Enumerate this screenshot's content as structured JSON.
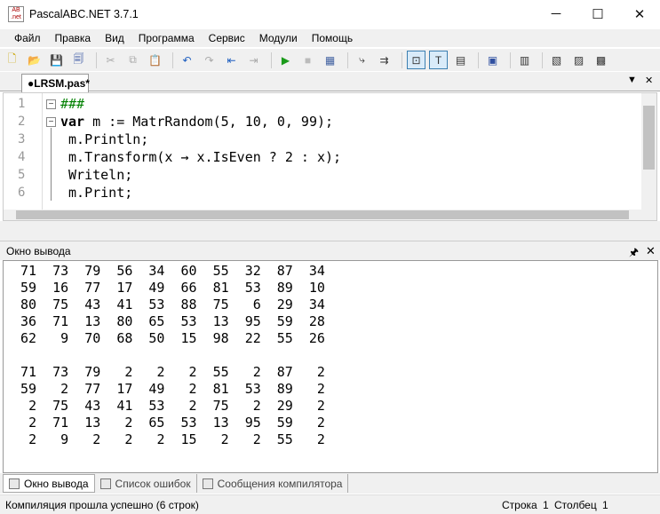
{
  "window": {
    "title": "PascalABC.NET 3.7.1",
    "icon_text": "AB .net",
    "minimize": "─",
    "maximize": "☐",
    "close": "✕"
  },
  "menu": [
    "Файл",
    "Правка",
    "Вид",
    "Программа",
    "Сервис",
    "Модули",
    "Помощь"
  ],
  "toolbar": [
    {
      "name": "new-file-icon",
      "glyph": "🗋",
      "color": "#c9a400"
    },
    {
      "name": "open-icon",
      "glyph": "📂",
      "color": "#d89a20"
    },
    {
      "name": "save-icon",
      "glyph": "💾",
      "color": "#3050a0"
    },
    {
      "name": "save-all-icon",
      "glyph": "🗐",
      "color": "#3050a0"
    },
    {
      "sep": true
    },
    {
      "name": "cut-icon",
      "glyph": "✂",
      "color": "#aaa"
    },
    {
      "name": "copy-icon",
      "glyph": "⧉",
      "color": "#aaa"
    },
    {
      "name": "paste-icon",
      "glyph": "📋",
      "color": "#a07020"
    },
    {
      "sep": true
    },
    {
      "name": "undo-icon",
      "glyph": "↶",
      "color": "#2060c0"
    },
    {
      "name": "redo-icon",
      "glyph": "↷",
      "color": "#aaa"
    },
    {
      "name": "indent-left-icon",
      "glyph": "⇤",
      "color": "#2060c0"
    },
    {
      "name": "indent-right-icon",
      "glyph": "⇥",
      "color": "#aaa"
    },
    {
      "sep": true
    },
    {
      "name": "run-icon",
      "glyph": "▶",
      "color": "#1a9a1a"
    },
    {
      "name": "stop-icon",
      "glyph": "■",
      "color": "#bbb"
    },
    {
      "name": "compile-icon",
      "glyph": "▦",
      "color": "#4060a0"
    },
    {
      "sep": true
    },
    {
      "name": "step-into-icon",
      "glyph": "⤷",
      "color": "#333"
    },
    {
      "name": "step-over-icon",
      "glyph": "⇉",
      "color": "#333"
    },
    {
      "sep": true
    },
    {
      "name": "output-window-icon",
      "glyph": "⊡",
      "color": "#333",
      "active": true
    },
    {
      "name": "text-window-icon",
      "glyph": "T",
      "color": "#333",
      "active": true
    },
    {
      "name": "format-icon",
      "glyph": "▤",
      "color": "#333"
    },
    {
      "sep": true
    },
    {
      "name": "debug-icon",
      "glyph": "▣",
      "color": "#3050a0"
    },
    {
      "sep": true
    },
    {
      "name": "code-icon",
      "glyph": "▥",
      "color": "#333"
    },
    {
      "sep": true
    },
    {
      "name": "form-icon",
      "glyph": "▧",
      "color": "#333"
    },
    {
      "name": "form-design-icon",
      "glyph": "▨",
      "color": "#333"
    },
    {
      "name": "form-run-icon",
      "glyph": "▩",
      "color": "#333"
    }
  ],
  "document_tab": {
    "label": "●LRSM.pas*",
    "menu": "▼",
    "close": "✕"
  },
  "editor": {
    "line_numbers": [
      "1",
      "2",
      "3",
      "4",
      "5",
      "6"
    ],
    "lines": [
      [
        {
          "t": "###",
          "c": "#008000"
        }
      ],
      [
        {
          "t": "var",
          "b": true
        },
        {
          "t": " m := MatrRandom(5, 10, 0, 99);"
        }
      ],
      [
        {
          "t": " m.Println;"
        }
      ],
      [
        {
          "t": " m.Transform(x → x.IsEven ? 2 : x);"
        }
      ],
      [
        {
          "t": " Writeln;"
        }
      ],
      [
        {
          "t": " m.Print;"
        }
      ]
    ]
  },
  "output_panel": {
    "title": "Окно вывода",
    "pin": "🖈",
    "close": "✕",
    "matrix_before": [
      [
        71,
        73,
        79,
        56,
        34,
        60,
        55,
        32,
        87,
        34
      ],
      [
        59,
        16,
        77,
        17,
        49,
        66,
        81,
        53,
        89,
        10
      ],
      [
        80,
        75,
        43,
        41,
        53,
        88,
        75,
        6,
        29,
        34
      ],
      [
        36,
        71,
        13,
        80,
        65,
        53,
        13,
        95,
        59,
        28
      ],
      [
        62,
        9,
        70,
        68,
        50,
        15,
        98,
        22,
        55,
        26
      ]
    ],
    "matrix_after": [
      [
        71,
        73,
        79,
        2,
        2,
        2,
        55,
        2,
        87,
        2
      ],
      [
        59,
        2,
        77,
        17,
        49,
        2,
        81,
        53,
        89,
        2
      ],
      [
        2,
        75,
        43,
        41,
        53,
        2,
        75,
        2,
        29,
        2
      ],
      [
        2,
        71,
        13,
        2,
        65,
        53,
        13,
        95,
        59,
        2
      ],
      [
        2,
        9,
        2,
        2,
        2,
        15,
        2,
        2,
        55,
        2
      ]
    ]
  },
  "bottom_tabs": [
    "Окно вывода",
    "Список ошибок",
    "Сообщения компилятора"
  ],
  "status": {
    "message": "Компиляция прошла успешно (6 строк)",
    "row_label": "Строка",
    "row": "1",
    "col_label": "Столбец",
    "col": "1"
  }
}
